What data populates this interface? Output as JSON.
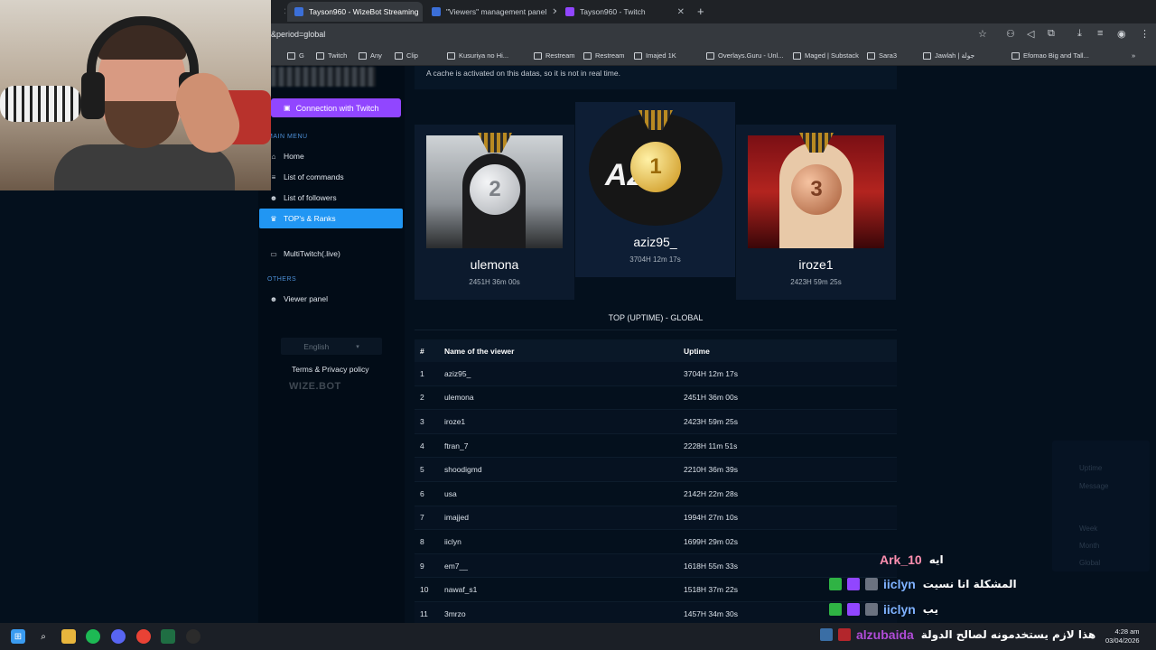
{
  "browser": {
    "tabs": [
      {
        "title": "Tayson960 - WizeBot Streaming",
        "active": true,
        "favicon_color": "#3b6fd8"
      },
      {
        "title": "\"Viewers\" management panel",
        "active": false,
        "favicon_color": "#3b6fd8"
      },
      {
        "title": "Tayson960 - Twitch",
        "active": false,
        "favicon_color": "#9146ff"
      }
    ],
    "new_tab_label": "+",
    "url": "&period=global",
    "bookmarks": [
      "G",
      "Twitch",
      "Any",
      "Clip",
      "Kusuriya no Hi...",
      "Restream",
      "Restream",
      "Imajed 1K",
      "Overlays.Guru - Unl...",
      "Maged | Substack",
      "Sara3",
      "Jawlah | جولة",
      "Efomao Big and Tall..."
    ]
  },
  "sidebar": {
    "connect_button": "Connection with Twitch",
    "main_menu_title": "MAIN MENU",
    "main_items": [
      {
        "label": "Home",
        "icon": "home-icon",
        "glyph": "⌂"
      },
      {
        "label": "List of commands",
        "icon": "list-icon",
        "glyph": "≡"
      },
      {
        "label": "List of followers",
        "icon": "users-icon",
        "glyph": "☻"
      },
      {
        "label": "TOP's & Ranks",
        "icon": "trophy-icon",
        "glyph": "♛",
        "active": true
      },
      {
        "label": "MultiTwitch(.live)",
        "icon": "monitor-icon",
        "glyph": "▭"
      }
    ],
    "others_title": "OTHERS",
    "other_items": [
      {
        "label": "Viewer panel",
        "icon": "users-icon",
        "glyph": "☻"
      }
    ],
    "language": "English",
    "terms": "Terms & Privacy policy",
    "powered_by": "WIZE.BOT"
  },
  "main": {
    "cache_note": "A cache is activated on this datas, so it is not in real time.",
    "podium": [
      {
        "rank": "2",
        "name": "ulemona",
        "time": "2451H 36m 00s",
        "medal_color": "#c9ccd0"
      },
      {
        "rank": "1",
        "name": "aziz95_",
        "time": "3704H 12m 17s",
        "medal_color": "#e0b53a"
      },
      {
        "rank": "3",
        "name": "iroze1",
        "time": "2423H 59m 25s",
        "medal_color": "#c47a5a"
      }
    ],
    "table_title": "TOP (UPTIME) - GLOBAL",
    "columns": [
      "#",
      "Name of the viewer",
      "Uptime"
    ],
    "rows": [
      [
        "1",
        "aziz95_",
        "3704H 12m 17s"
      ],
      [
        "2",
        "ulemona",
        "2451H 36m 00s"
      ],
      [
        "3",
        "iroze1",
        "2423H 59m 25s"
      ],
      [
        "4",
        "ftran_7",
        "2228H 11m 51s"
      ],
      [
        "5",
        "shoodigmd",
        "2210H 36m 39s"
      ],
      [
        "6",
        "usa",
        "2142H 22m 28s"
      ],
      [
        "7",
        "imajjed",
        "1994H 27m 10s"
      ],
      [
        "8",
        "iiclyn",
        "1699H 29m 02s"
      ],
      [
        "9",
        "em7__",
        "1618H 55m 33s"
      ],
      [
        "10",
        "nawaf_s1",
        "1518H 37m 22s"
      ],
      [
        "11",
        "3mrzo",
        "1457H 34m 30s"
      ]
    ],
    "ghost_panel": [
      "Uptime",
      "Message",
      "Week",
      "Month",
      "Global"
    ]
  },
  "chat": [
    {
      "user": "Ark_10",
      "message": "ايه",
      "user_color": "#ff8fb0"
    },
    {
      "user": "iiclyn",
      "message": "المشكلة انا نسيت",
      "user_color": "#7fb2ff"
    },
    {
      "user": "iiclyn",
      "message": "يب",
      "user_color": "#7fb2ff"
    },
    {
      "user": "alzubaida",
      "message": "هذا لازم يستخدمونه لصالح الدولة",
      "user_color": "#b14cd8"
    }
  ],
  "taskbar": {
    "time": "4:28 am",
    "date": "03/04/2026"
  }
}
